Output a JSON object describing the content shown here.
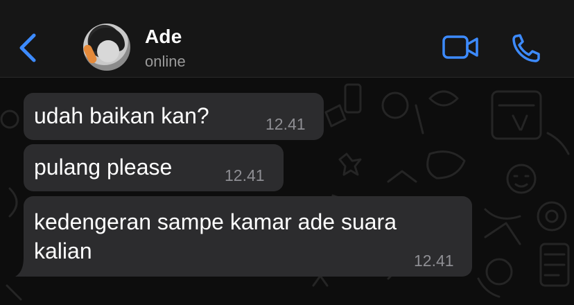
{
  "header": {
    "back_icon": "chevron-left-icon",
    "contact_name": "Ade",
    "contact_status": "online",
    "video_icon": "video-camera-icon",
    "call_icon": "phone-icon",
    "accent_color": "#3d8bff"
  },
  "messages": [
    {
      "text": "udah baikan kan?",
      "time": "12.41"
    },
    {
      "text": "pulang please",
      "time": "12.41"
    },
    {
      "text": "kedengeran sampe kamar ade suara kalian",
      "time": "12.41"
    }
  ],
  "colors": {
    "bubble": "#2c2c2e",
    "background": "#0d0d0d",
    "timestamp": "#8e8e93"
  }
}
